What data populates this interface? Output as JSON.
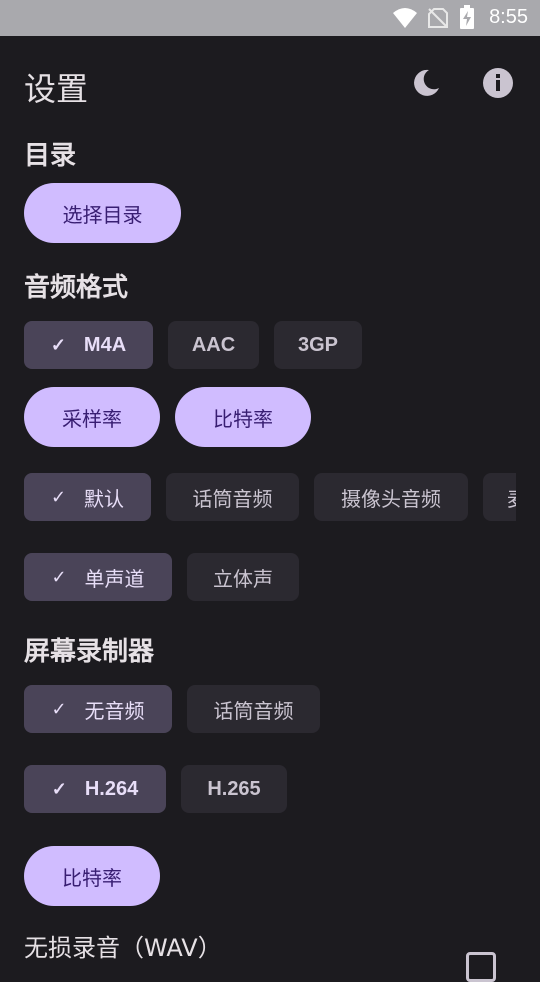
{
  "status_bar": {
    "time": "8:55"
  },
  "header": {
    "title": "设置",
    "theme_icon": "moon-icon",
    "info_icon": "info-icon"
  },
  "directory": {
    "title": "目录",
    "select_button": "选择目录"
  },
  "audio_format": {
    "title": "音频格式",
    "formats": [
      {
        "label": "M4A",
        "selected": true
      },
      {
        "label": "AAC",
        "selected": false
      },
      {
        "label": "3GP",
        "selected": false
      }
    ],
    "sample_rate_button": "采样率",
    "bitrate_button": "比特率",
    "sources": [
      {
        "label": "默认",
        "selected": true
      },
      {
        "label": "话筒音频",
        "selected": false
      },
      {
        "label": "摄像头音频",
        "selected": false
      },
      {
        "label": "麦",
        "selected": false
      }
    ],
    "channels": [
      {
        "label": "单声道",
        "selected": true
      },
      {
        "label": "立体声",
        "selected": false
      }
    ]
  },
  "screen_recorder": {
    "title": "屏幕录制器",
    "audio": [
      {
        "label": "无音频",
        "selected": true
      },
      {
        "label": "话筒音频",
        "selected": false
      }
    ],
    "codecs": [
      {
        "label": "H.264",
        "selected": true
      },
      {
        "label": "H.265",
        "selected": false
      }
    ],
    "bitrate_button": "比特率"
  },
  "lossless": {
    "label": "无损录音（WAV）"
  },
  "colors": {
    "background": "#1c1b1f",
    "primary_container": "#d0bcff",
    "selected_chip": "#4a4458",
    "chip": "#2b2930"
  }
}
